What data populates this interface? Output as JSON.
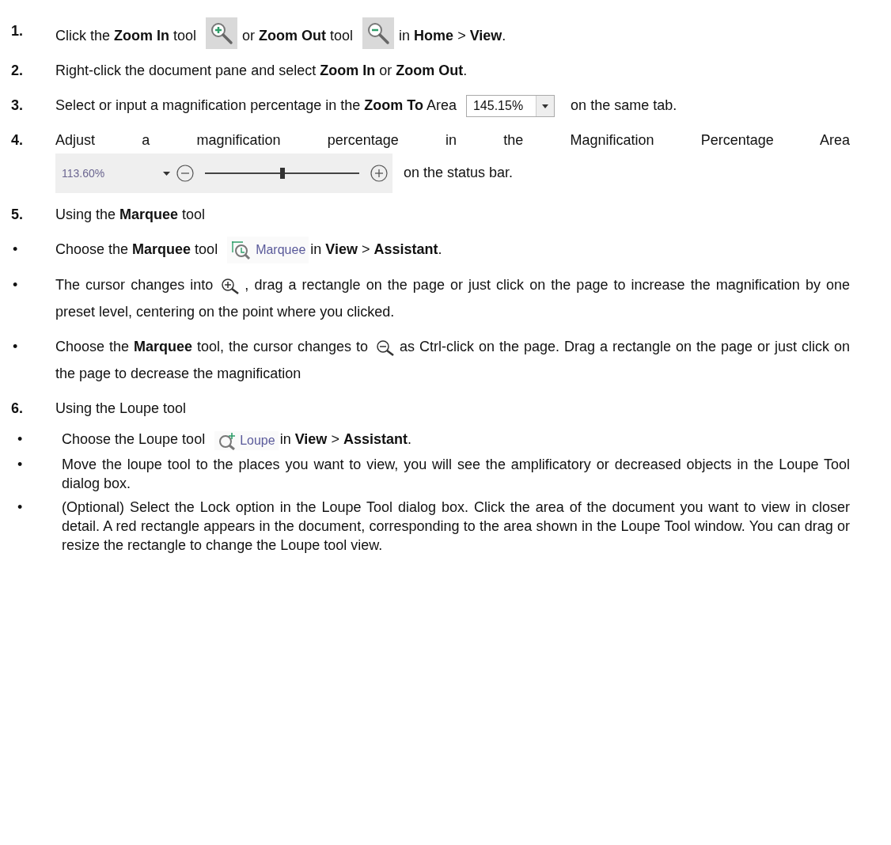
{
  "steps": [
    {
      "kind": "step",
      "marker": "1.",
      "segments": [
        {
          "kind": "text",
          "text": "Click the **Zoom In** tool"
        },
        {
          "kind": "zoom_in_tool"
        },
        {
          "kind": "text",
          "text": "or **Zoom Out** tool"
        },
        {
          "kind": "zoom_out_tool"
        },
        {
          "kind": "text",
          "text": "in **Home** > **View**."
        }
      ]
    },
    {
      "kind": "step",
      "marker": "2.",
      "segments": [
        {
          "kind": "text",
          "text": "Right-click the document pane and select **Zoom In** or **Zoom Out**."
        }
      ]
    },
    {
      "kind": "step",
      "marker": "3.",
      "segments": [
        {
          "kind": "text",
          "text": "Select or input a magnification percentage in the **Zoom To** Area"
        },
        {
          "kind": "zoom_box",
          "value": "145.15%"
        },
        {
          "kind": "text",
          "text": "on the same tab."
        }
      ]
    },
    {
      "kind": "step",
      "marker": "4.",
      "segments": [
        {
          "kind": "text",
          "text": "Adjust a magnification percentage in the Magnification Percentage Area"
        },
        {
          "kind": "magnification_bar",
          "value": "113.60%",
          "level": 0.5
        },
        {
          "kind": "text",
          "text": "on the status bar."
        }
      ]
    },
    {
      "kind": "step",
      "marker": "5.",
      "segments": [
        {
          "kind": "text",
          "text": "Using the **Marquee** tool"
        }
      ]
    },
    {
      "kind": "bullet",
      "marker": "•",
      "segments": [
        {
          "kind": "text",
          "text": "Choose the **Marquee** tool"
        },
        {
          "kind": "marquee_tool",
          "label": "Marquee"
        },
        {
          "kind": "text",
          "text": "in **View** > **Assistant**."
        }
      ]
    },
    {
      "kind": "bullet",
      "marker": "•",
      "segments": [
        {
          "kind": "text",
          "text": "The cursor changes into"
        },
        {
          "kind": "zoom_in_cursor"
        },
        {
          "kind": "text",
          "text": ", drag a rectangle on the page or just click on the page to increase the magnification by one preset level, centering on the point where you clicked."
        }
      ]
    },
    {
      "kind": "bullet",
      "marker": "•",
      "segments": [
        {
          "kind": "text",
          "text": "Choose the **Marquee** tool, the cursor changes to"
        },
        {
          "kind": "zoom_out_cursor"
        },
        {
          "kind": "text",
          "text": "as Ctrl-click on the page. Drag a rectangle on the page or just click on the page to decrease the magnification"
        }
      ]
    },
    {
      "kind": "step",
      "marker": "6.",
      "segments": [
        {
          "kind": "text",
          "text": "Using the Loupe tool"
        }
      ]
    },
    {
      "kind": "sub_bullet",
      "marker": "•",
      "segments": [
        {
          "kind": "text",
          "text": "Choose the Loupe tool"
        },
        {
          "kind": "loupe_tool",
          "label": "Loupe"
        },
        {
          "kind": "text",
          "text": "in **View** > **Assistant**."
        }
      ]
    },
    {
      "kind": "sub_bullet",
      "marker": "•",
      "segments": [
        {
          "kind": "text",
          "text": "Move the loupe tool to the places you want to view, you will see the amplificatory or decreased objects in the Loupe Tool dialog box."
        }
      ]
    },
    {
      "kind": "sub_bullet",
      "marker": "•",
      "segments": [
        {
          "kind": "text",
          "text": "(Optional) Select the Lock option in the Loupe Tool dialog box. Click the area of the document you want to view in closer detail. A red rectangle appears in the document, corresponding to the area shown in the Loupe Tool window. You can drag or resize the rectangle to change the Loupe tool view."
        }
      ]
    }
  ]
}
